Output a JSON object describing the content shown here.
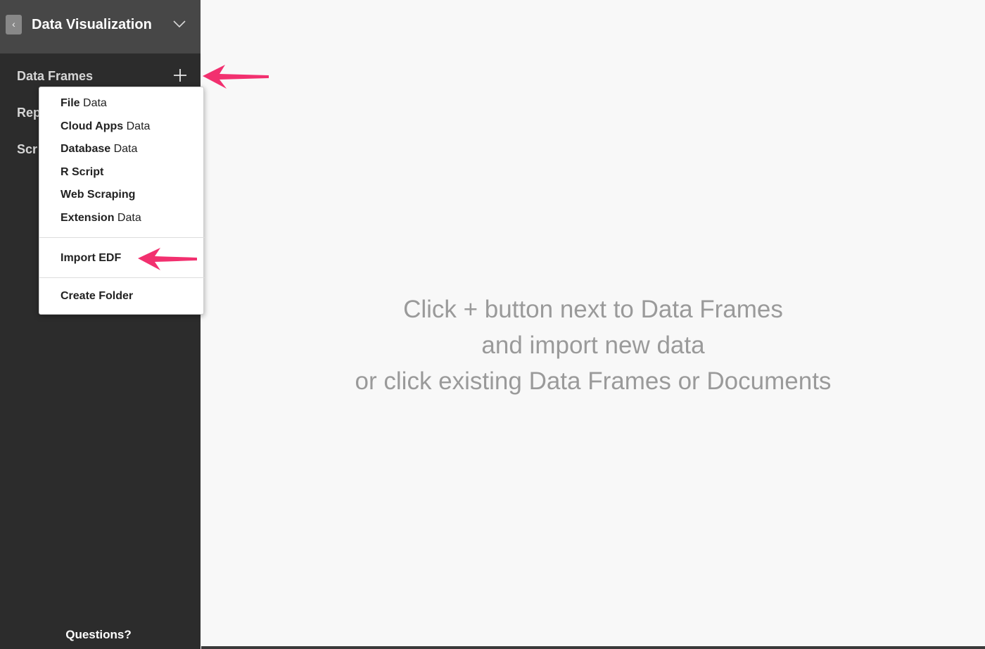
{
  "header": {
    "back_icon": "chevron-left-icon",
    "title": "Data Visualization",
    "dropdown_icon": "chevron-down-icon"
  },
  "sidebar": {
    "sections": [
      {
        "label": "Data Frames"
      },
      {
        "label": "Rep"
      },
      {
        "label": "Scr"
      }
    ],
    "add_icon": "plus-icon",
    "footer": "Questions?"
  },
  "menu": {
    "items": [
      {
        "bold": "File",
        "rest": " Data"
      },
      {
        "bold": "Cloud Apps",
        "rest": " Data"
      },
      {
        "bold": "Database",
        "rest": " Data"
      },
      {
        "bold": "R Script",
        "rest": ""
      },
      {
        "bold": "Web Scraping",
        "rest": ""
      },
      {
        "bold": "Extension",
        "rest": " Data"
      }
    ],
    "import_edf": "Import EDF",
    "create_folder": "Create Folder"
  },
  "main": {
    "message_lines": [
      "Click + button next to Data Frames",
      "and import new data",
      "or click existing Data Frames or Documents"
    ]
  },
  "annotation": {
    "arrow_color": "#f2306f"
  }
}
